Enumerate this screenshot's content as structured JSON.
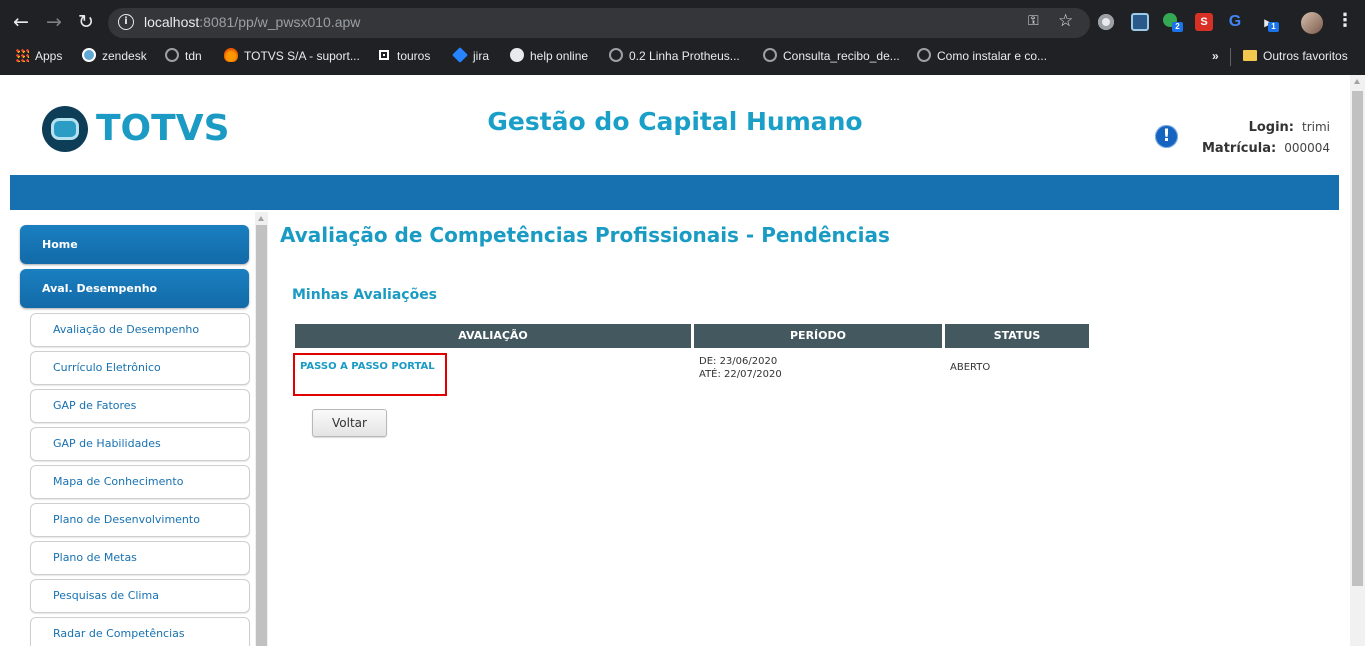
{
  "browser": {
    "url_host": "localhost",
    "url_path": ":8081/pp/w_pwsx010.apw",
    "bookmarks": [
      {
        "label": "Apps",
        "icon": "apps-grid-icon"
      },
      {
        "label": "zendesk",
        "icon": "zendesk-icon"
      },
      {
        "label": "tdn",
        "icon": "tdn-icon"
      },
      {
        "label": "TOTVS S/A - suport...",
        "icon": "totvs-support-icon"
      },
      {
        "label": "touros",
        "icon": "touros-icon"
      },
      {
        "label": "jira",
        "icon": "jira-icon"
      },
      {
        "label": "help online",
        "icon": "help-online-icon"
      },
      {
        "label": "0.2 Linha Protheus...",
        "icon": "protheus-icon"
      },
      {
        "label": "Consulta_recibo_de...",
        "icon": "consulta-icon"
      },
      {
        "label": "Como instalar e co...",
        "icon": "como-instalar-icon"
      }
    ],
    "overflow_label": "»",
    "other_bookmarks": "Outros favoritos",
    "extension_badges": [
      "2",
      "1"
    ]
  },
  "header": {
    "logo_text": "TOTVS",
    "app_title": "Gestão do Capital Humano",
    "alert_glyph": "!",
    "login_label": "Login:",
    "login_value": "trimi",
    "matricula_label": "Matrícula:",
    "matricula_value": "000004"
  },
  "sidebar": {
    "main_items": [
      {
        "label": "Home"
      },
      {
        "label": "Aval. Desempenho"
      }
    ],
    "sub_items": [
      {
        "label": "Avaliação de Desempenho"
      },
      {
        "label": "Currículo Eletrônico"
      },
      {
        "label": "GAP de Fatores"
      },
      {
        "label": "GAP de Habilidades"
      },
      {
        "label": "Mapa de Conhecimento"
      },
      {
        "label": "Plano de Desenvolvimento"
      },
      {
        "label": "Plano de Metas"
      },
      {
        "label": "Pesquisas de Clima"
      },
      {
        "label": "Radar de Competências"
      }
    ]
  },
  "content": {
    "title": "Avaliação de Competências Profissionais - Pendências",
    "section_title": "Minhas Avaliações",
    "table": {
      "columns": [
        "AVALIAÇÃO",
        "PERÍODO",
        "STATUS"
      ],
      "rows": [
        {
          "avaliacao": "PASSO A PASSO PORTAL",
          "periodo_de": "DE: 23/06/2020",
          "periodo_ate": "ATÉ: 22/07/2020",
          "status": "ABERTO"
        }
      ]
    },
    "back_button": "Voltar"
  },
  "colors": {
    "brand_blue": "#1771b1",
    "title_cyan": "#1a9bc4",
    "table_header": "#445860",
    "highlight_red": "#e00000"
  }
}
